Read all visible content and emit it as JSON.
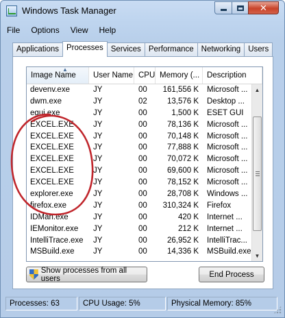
{
  "window": {
    "title": "Windows Task Manager",
    "close_glyph": "✕",
    "maximize_glyph": "□",
    "minimize_glyph": "–"
  },
  "menu": [
    "File",
    "Options",
    "View",
    "Help"
  ],
  "tabs": [
    "Applications",
    "Processes",
    "Services",
    "Performance",
    "Networking",
    "Users"
  ],
  "active_tab": "Processes",
  "columns": [
    "Image Name",
    "User Name",
    "CPU",
    "Memory (...",
    "Description"
  ],
  "sorted_column": "Image Name",
  "processes": [
    {
      "name": "devenv.exe",
      "user": "JY",
      "cpu": "00",
      "memory": "161,556 K",
      "description": "Microsoft ..."
    },
    {
      "name": "dwm.exe",
      "user": "JY",
      "cpu": "02",
      "memory": "13,576 K",
      "description": "Desktop ..."
    },
    {
      "name": "egui.exe",
      "user": "JY",
      "cpu": "00",
      "memory": "1,500 K",
      "description": "ESET GUI"
    },
    {
      "name": "EXCEL.EXE",
      "user": "JY",
      "cpu": "00",
      "memory": "78,136 K",
      "description": "Microsoft ..."
    },
    {
      "name": "EXCEL.EXE",
      "user": "JY",
      "cpu": "00",
      "memory": "70,148 K",
      "description": "Microsoft ..."
    },
    {
      "name": "EXCEL.EXE",
      "user": "JY",
      "cpu": "00",
      "memory": "77,888 K",
      "description": "Microsoft ..."
    },
    {
      "name": "EXCEL.EXE",
      "user": "JY",
      "cpu": "00",
      "memory": "70,072 K",
      "description": "Microsoft ..."
    },
    {
      "name": "EXCEL.EXE",
      "user": "JY",
      "cpu": "00",
      "memory": "69,600 K",
      "description": "Microsoft ..."
    },
    {
      "name": "EXCEL.EXE",
      "user": "JY",
      "cpu": "00",
      "memory": "78,152 K",
      "description": "Microsoft ..."
    },
    {
      "name": "explorer.exe",
      "user": "JY",
      "cpu": "00",
      "memory": "28,708 K",
      "description": "Windows ..."
    },
    {
      "name": "firefox.exe",
      "user": "JY",
      "cpu": "00",
      "memory": "310,324 K",
      "description": "Firefox"
    },
    {
      "name": "IDMan.exe",
      "user": "JY",
      "cpu": "00",
      "memory": "420 K",
      "description": "Internet ..."
    },
    {
      "name": "IEMonitor.exe",
      "user": "JY",
      "cpu": "00",
      "memory": "212 K",
      "description": "Internet ..."
    },
    {
      "name": "IntelliTrace.exe",
      "user": "JY",
      "cpu": "00",
      "memory": "26,952 K",
      "description": "IntelliTrac..."
    },
    {
      "name": "MSBuild.exe",
      "user": "JY",
      "cpu": "00",
      "memory": "14,336 K",
      "description": "MSBuild.exe"
    }
  ],
  "buttons": {
    "show_all": "Show processes from all users",
    "end_process": "End Process"
  },
  "status": {
    "processes": "Processes: 63",
    "cpu_usage": "CPU Usage: 5%",
    "physical_memory": "Physical Memory: 85%"
  },
  "colors": {
    "annotation": "#c0262c",
    "close_button": "#c8442a",
    "window_frame": "#bfd5ef"
  }
}
